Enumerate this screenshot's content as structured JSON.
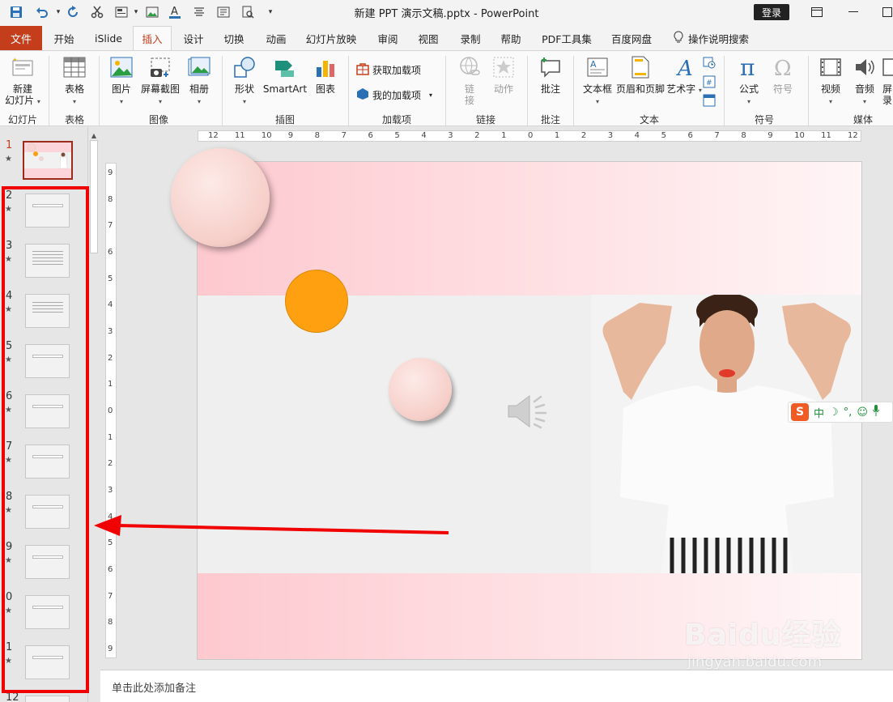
{
  "window": {
    "title": "新建 PPT 演示文稿.pptx  -  PowerPoint",
    "login_label": "登录"
  },
  "quick_access": [
    "save-icon",
    "undo-icon",
    "redo-icon",
    "cut-icon",
    "layout-icon",
    "font-color-icon",
    "align-icon",
    "text-box-icon",
    "preview-icon",
    "customize-icon"
  ],
  "tabs": {
    "file": "文件",
    "items": [
      "开始",
      "iSlide",
      "插入",
      "设计",
      "切换",
      "动画",
      "幻灯片放映",
      "审阅",
      "视图",
      "录制",
      "帮助",
      "PDF工具集",
      "百度网盘"
    ],
    "active": "插入",
    "tell_me": "操作说明搜索"
  },
  "ribbon": {
    "groups": {
      "slides": "幻灯片",
      "tables": "表格",
      "images": "图像",
      "illustrations": "插图",
      "addins": "加载项",
      "links": "链接",
      "comments": "批注",
      "text": "文本",
      "symbols": "符号",
      "media": "媒体"
    },
    "buttons": {
      "new_slide_1": "新建",
      "new_slide_2": "幻灯片",
      "table": "表格",
      "pictures": "图片",
      "screenshot": "屏幕截图",
      "album": "相册",
      "shapes": "形状",
      "smartart": "SmartArt",
      "chart": "图表",
      "get_addins": "获取加载项",
      "my_addins": "我的加载项",
      "link_1": "链",
      "link_2": "接",
      "action": "动作",
      "comment": "批注",
      "textbox": "文本框",
      "header_footer": "页眉和页脚",
      "wordart": "艺术字",
      "equation": "公式",
      "symbol": "符号",
      "video": "视频",
      "audio": "音频",
      "screen_rec_1": "屏",
      "screen_rec_2": "录"
    }
  },
  "slides_pane": {
    "numbers": [
      "1",
      "2",
      "3",
      "4",
      "5",
      "6",
      "7",
      "8",
      "9",
      "0",
      "1",
      "12"
    ],
    "selected": "1",
    "star": "★",
    "scroll_up": "▲"
  },
  "rulers": {
    "horizontal": [
      "12",
      "11",
      "10",
      "9",
      "8",
      "7",
      "6",
      "5",
      "4",
      "3",
      "2",
      "1",
      "0",
      "1",
      "2",
      "3",
      "4",
      "5",
      "6",
      "7",
      "8",
      "9",
      "10",
      "11",
      "12"
    ],
    "vertical": [
      "9",
      "8",
      "7",
      "6",
      "5",
      "4",
      "3",
      "2",
      "1",
      "0",
      "1",
      "2",
      "3",
      "4",
      "5",
      "6",
      "7",
      "8",
      "9"
    ]
  },
  "notes": {
    "placeholder": "单击此处添加备注"
  },
  "ime": {
    "logo": "S",
    "mode": "中",
    "moon": "☽",
    "punct": "°,",
    "emoji": "☺"
  },
  "watermark": {
    "text": "Baidu经验",
    "sub": "jingyan.baidu.com"
  },
  "colors": {
    "accent": "#c43e1c",
    "annotation": "#f00000",
    "orange_circle": "#ffa010",
    "pink_circle": "#f8d0cc"
  }
}
